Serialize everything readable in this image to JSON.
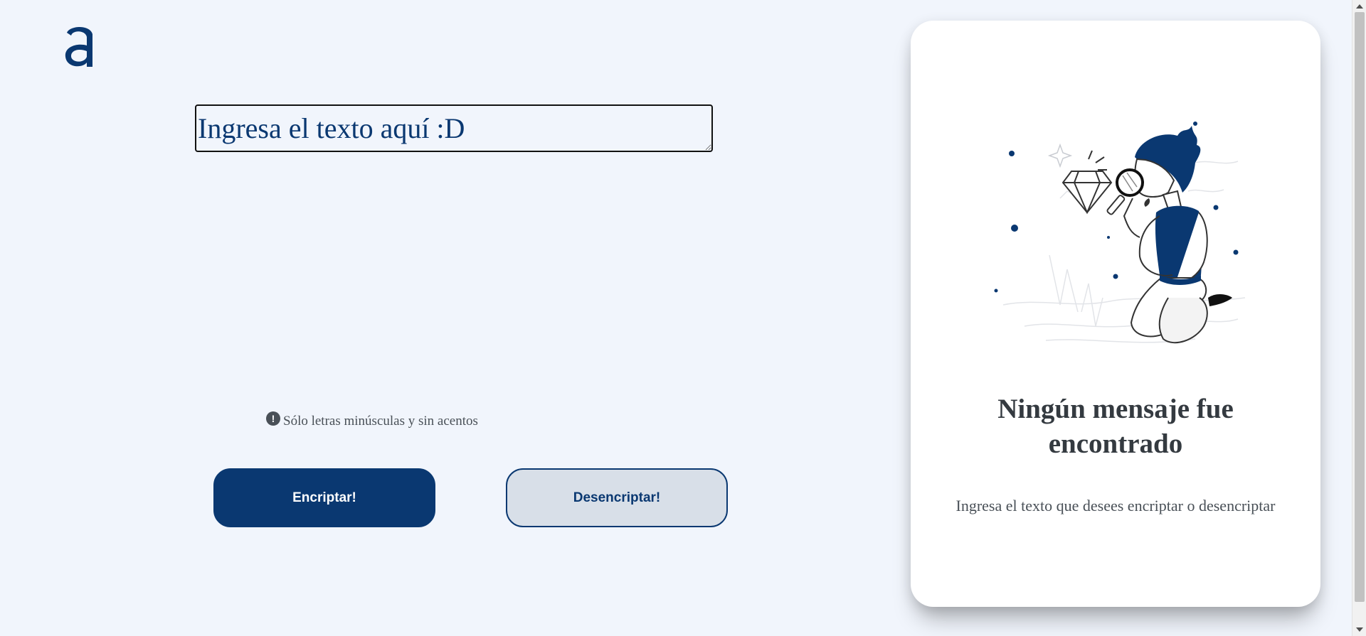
{
  "brand": {
    "logo_icon": "alura-a-logo",
    "color": "#0a3871"
  },
  "input": {
    "placeholder": "Ingresa el texto aquí :D",
    "value": ""
  },
  "hint": {
    "icon": "exclamation-circle-icon",
    "text": "Sólo letras minúsculas y sin acentos"
  },
  "buttons": {
    "encrypt_label": "Encriptar!",
    "decrypt_label": "Desencriptar!"
  },
  "panel": {
    "illustration": "person-with-magnifier-and-diamond",
    "title": "Ningún mensaje fue encontrado",
    "subtitle": "Ingresa el texto que desees encriptar o desencriptar"
  },
  "colors": {
    "background": "#f1f5fc",
    "primary": "#0a3871",
    "secondary_button": "#d8dfe8",
    "panel": "#ffffff"
  }
}
